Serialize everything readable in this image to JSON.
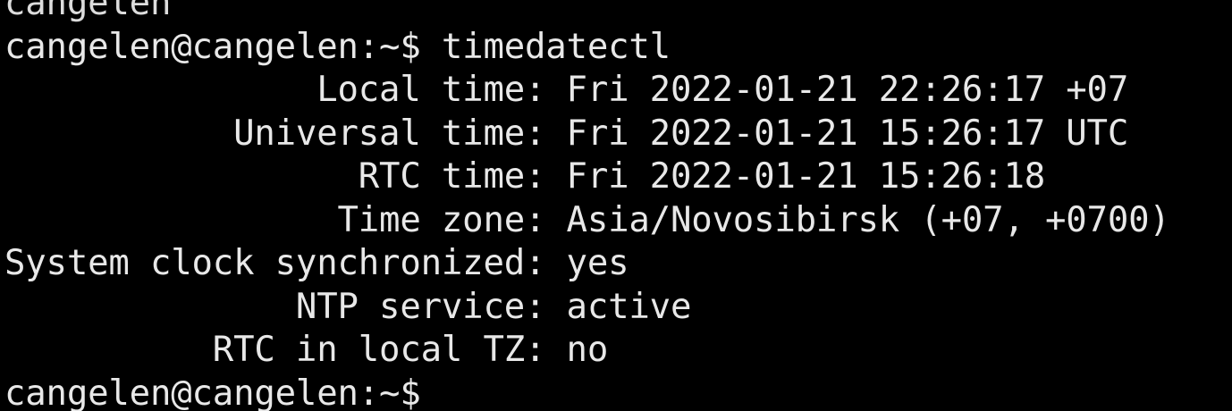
{
  "terminal": {
    "lines": [
      {
        "text": "cangelen"
      },
      {
        "text": "cangelen@cangelen:~$ timedatectl"
      },
      {
        "text": "               Local time: Fri 2022-01-21 22:26:17 +07"
      },
      {
        "text": "           Universal time: Fri 2022-01-21 15:26:17 UTC"
      },
      {
        "text": "                 RTC time: Fri 2022-01-21 15:26:18"
      },
      {
        "text": "                Time zone: Asia/Novosibirsk (+07, +0700)"
      },
      {
        "text": "System clock synchronized: yes"
      },
      {
        "text": "              NTP service: active"
      },
      {
        "text": "          RTC in local TZ: no"
      },
      {
        "text": "cangelen@cangelen:~$ "
      }
    ]
  }
}
